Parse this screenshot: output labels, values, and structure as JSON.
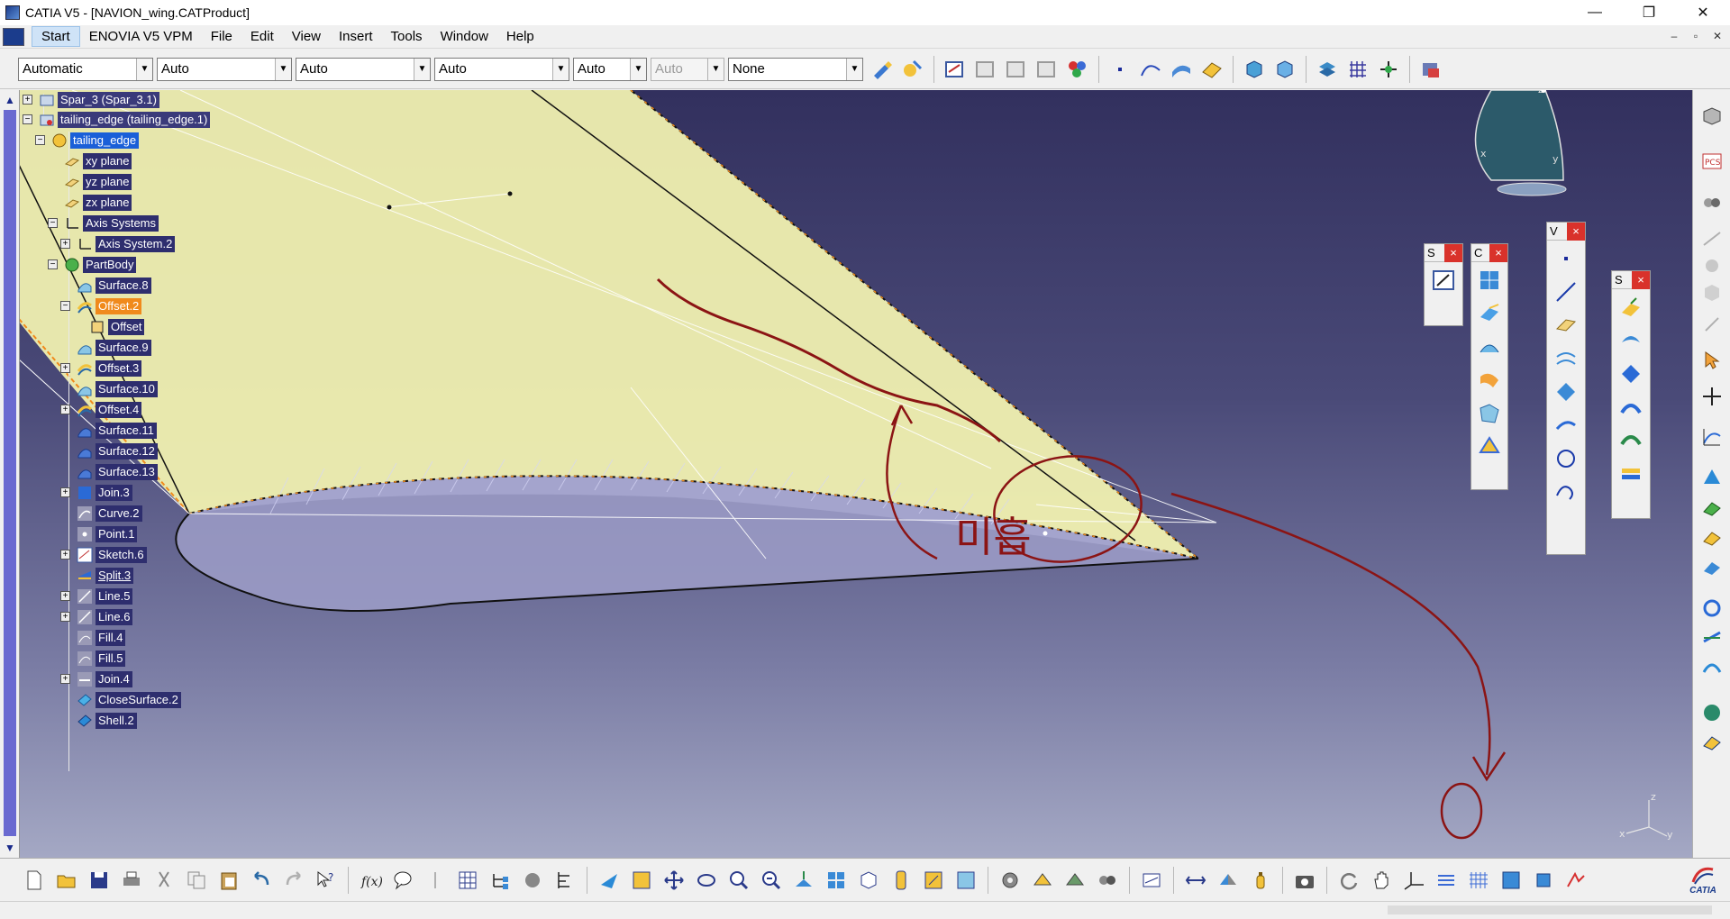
{
  "window": {
    "title": "CATIA V5 - [NAVION_wing.CATProduct]",
    "controls": [
      "—",
      "❐",
      "✕"
    ]
  },
  "menu": {
    "items": [
      "Start",
      "ENOVIA V5 VPM",
      "File",
      "Edit",
      "View",
      "Insert",
      "Tools",
      "Window",
      "Help"
    ],
    "doc_controls": [
      "–",
      "▫",
      "✕"
    ]
  },
  "toolbar_top": {
    "combos": [
      {
        "value": "Automatic",
        "enabled": true
      },
      {
        "value": "Auto",
        "enabled": true
      },
      {
        "value": "Auto",
        "enabled": true
      },
      {
        "value": "Auto",
        "enabled": true
      },
      {
        "value": "Auto",
        "enabled": true
      },
      {
        "value": "Auto",
        "enabled": false
      },
      {
        "value": "None",
        "enabled": true
      }
    ]
  },
  "spec_tree": {
    "nodes": [
      {
        "label": "Spar_3 (Spar_3.1)",
        "style": "root"
      },
      {
        "label": "tailing_edge (tailing_edge.1)",
        "style": "root"
      },
      {
        "label": "tailing_edge",
        "style": "selected"
      },
      {
        "label": "xy plane",
        "style": "normal"
      },
      {
        "label": "yz plane",
        "style": "normal"
      },
      {
        "label": "zx plane",
        "style": "normal"
      },
      {
        "label": "Axis Systems",
        "style": "normal"
      },
      {
        "label": "Axis System.2",
        "style": "normal"
      },
      {
        "label": "PartBody",
        "style": "normal"
      },
      {
        "label": "Surface.8",
        "style": "normal"
      },
      {
        "label": "Offset.2",
        "style": "highlight"
      },
      {
        "label": "Offset",
        "style": "normal"
      },
      {
        "label": "Surface.9",
        "style": "normal"
      },
      {
        "label": "Offset.3",
        "style": "normal"
      },
      {
        "label": "Surface.10",
        "style": "normal"
      },
      {
        "label": "Offset.4",
        "style": "normal"
      },
      {
        "label": "Surface.11",
        "style": "normal"
      },
      {
        "label": "Surface.12",
        "style": "normal"
      },
      {
        "label": "Surface.13",
        "style": "normal"
      },
      {
        "label": "Join.3",
        "style": "normal"
      },
      {
        "label": "Curve.2",
        "style": "normal"
      },
      {
        "label": "Point.1",
        "style": "normal"
      },
      {
        "label": "Sketch.6",
        "style": "normal"
      },
      {
        "label": "Split.3",
        "style": "normal"
      },
      {
        "label": "Line.5",
        "style": "normal"
      },
      {
        "label": "Line.6",
        "style": "normal"
      },
      {
        "label": "Fill.4",
        "style": "normal"
      },
      {
        "label": "Fill.5",
        "style": "normal"
      },
      {
        "label": "Join.4",
        "style": "normal"
      },
      {
        "label": "CloseSurface.2",
        "style": "normal"
      },
      {
        "label": "Shell.2",
        "style": "normal"
      }
    ]
  },
  "floating_toolbars": [
    {
      "title": "S"
    },
    {
      "title": "C"
    },
    {
      "title": "V"
    },
    {
      "title": "S"
    }
  ],
  "annotation": {
    "handwritten_text": "미흡",
    "ink_color": "#8b1414"
  },
  "viewport": {
    "compass_axes": [
      "z",
      "x",
      "y"
    ],
    "corner_axes": [
      "z",
      "x",
      "y"
    ],
    "colors": {
      "surface_fill": "#f0f0b0",
      "edge_orange": "#f08a1c",
      "background_top": "#32305e",
      "background_bottom": "#a4a8c4"
    }
  },
  "logo": {
    "text": "CATIA"
  }
}
